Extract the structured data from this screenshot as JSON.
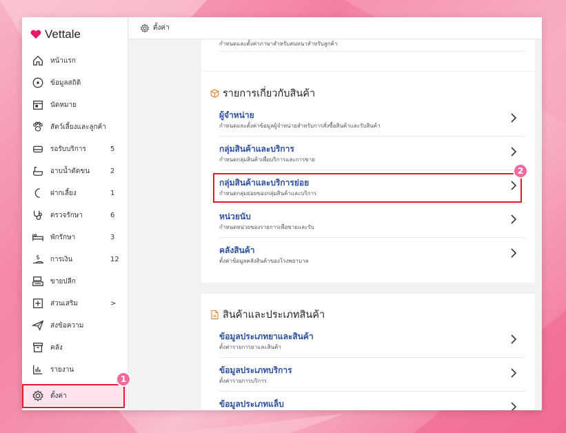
{
  "app": {
    "name": "Vettale",
    "brand_color": "#e8196b"
  },
  "topbar": {
    "title": "ตั้งค่า",
    "icon": "gear-icon"
  },
  "sidebar": {
    "items": [
      {
        "label": "หน้าแรก",
        "icon": "home-icon",
        "count": ""
      },
      {
        "label": "ข้อมูลสถิติ",
        "icon": "stats-icon",
        "count": ""
      },
      {
        "label": "นัดหมาย",
        "icon": "calendar-icon",
        "count": ""
      },
      {
        "label": "สัตว์เลี้ยงและลูกค้า",
        "icon": "paw-icon",
        "count": ""
      },
      {
        "label": "รอรับบริการ",
        "icon": "waiting-icon",
        "count": "5"
      },
      {
        "label": "อาบน้ำตัดขน",
        "icon": "bath-icon",
        "count": "2"
      },
      {
        "label": "ฝากเลี้ยง",
        "icon": "moon-icon",
        "count": "1"
      },
      {
        "label": "ตรวจรักษา",
        "icon": "stethoscope-icon",
        "count": "6"
      },
      {
        "label": "พักรักษา",
        "icon": "bed-icon",
        "count": "3"
      },
      {
        "label": "การเงิน",
        "icon": "money-icon",
        "count": "12"
      },
      {
        "label": "ขายปลีก",
        "icon": "register-icon",
        "count": ""
      },
      {
        "label": "ส่วนเสริม",
        "icon": "plus-square-icon",
        "count": ">"
      },
      {
        "label": "ส่งข้อความ",
        "icon": "send-icon",
        "count": ""
      },
      {
        "label": "คลัง",
        "icon": "archive-icon",
        "count": ""
      },
      {
        "label": "รายงาน",
        "icon": "chart-icon",
        "count": ""
      },
      {
        "label": "ตั้งค่า",
        "icon": "gear-icon",
        "count": ""
      }
    ]
  },
  "top_partial": {
    "desc": "กำหนดและตั้งค่าภาษาสำหรับสนทนาสำหรับลูกค้า"
  },
  "products_section": {
    "title": "รายการเกี่ยวกับสินค้า",
    "rows": [
      {
        "title": "ผู้จำหน่าย",
        "desc": "กำหนดและตั้งค่าข้อมูลผู้จำหน่ายสำหรับการสั่งซื้อสินค้าและรับสินค้า"
      },
      {
        "title": "กลุ่มสินค้าและบริการ",
        "desc": "กำหนดกลุ่มสินค้าเพื่อบริการและการขาย"
      },
      {
        "title": "กลุ่มสินค้าและบริการย่อย",
        "desc": "กำหนดกลุ่มย่อยของกลุ่มสินค้าและบริการ"
      },
      {
        "title": "หน่วยนับ",
        "desc": "กำหนดหน่วยของรายการเพื่อขายและรับ"
      },
      {
        "title": "คลังสินค้า",
        "desc": "ตั้งค่าข้อมูลคลังสินค้าของโรงพยาบาล"
      }
    ]
  },
  "types_section": {
    "title": "สินค้าและประเภทสินค้า",
    "rows": [
      {
        "title": "ข้อมูลประเภทยาและสินค้า",
        "desc": "ตั้งค่ารายการยาและสินค้า"
      },
      {
        "title": "ข้อมูลประเภทบริการ",
        "desc": "ตั้งค่ารายการบริการ"
      },
      {
        "title": "ข้อมูลประเภทแล็บ",
        "desc": ""
      }
    ]
  },
  "annotations": {
    "badge_1": "1",
    "badge_2": "2",
    "highlight_color": "#e01a2b",
    "badge_color": "#f06a9c"
  }
}
